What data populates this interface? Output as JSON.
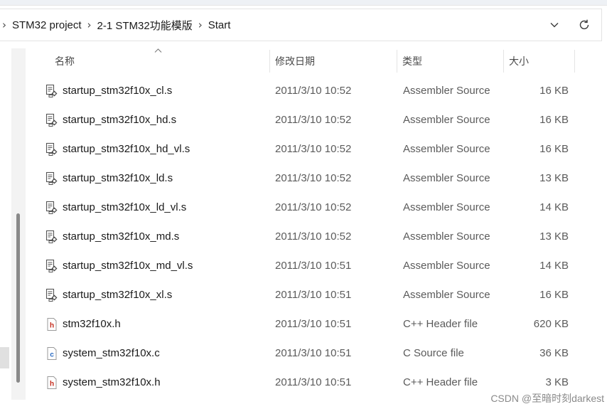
{
  "address": {
    "crumbs": [
      "STM32 project",
      "2-1 STM32功能模版",
      "Start"
    ],
    "separator": "›"
  },
  "columns": {
    "name": "名称",
    "date": "修改日期",
    "type": "类型",
    "size": "大小"
  },
  "files": [
    {
      "name": "startup_stm32f10x_cl.s",
      "date": "2011/3/10 10:52",
      "type": "Assembler Source",
      "size": "16 KB",
      "icon": "assembler-file-icon"
    },
    {
      "name": "startup_stm32f10x_hd.s",
      "date": "2011/3/10 10:52",
      "type": "Assembler Source",
      "size": "16 KB",
      "icon": "assembler-file-icon"
    },
    {
      "name": "startup_stm32f10x_hd_vl.s",
      "date": "2011/3/10 10:52",
      "type": "Assembler Source",
      "size": "16 KB",
      "icon": "assembler-file-icon"
    },
    {
      "name": "startup_stm32f10x_ld.s",
      "date": "2011/3/10 10:52",
      "type": "Assembler Source",
      "size": "13 KB",
      "icon": "assembler-file-icon"
    },
    {
      "name": "startup_stm32f10x_ld_vl.s",
      "date": "2011/3/10 10:52",
      "type": "Assembler Source",
      "size": "14 KB",
      "icon": "assembler-file-icon"
    },
    {
      "name": "startup_stm32f10x_md.s",
      "date": "2011/3/10 10:52",
      "type": "Assembler Source",
      "size": "13 KB",
      "icon": "assembler-file-icon"
    },
    {
      "name": "startup_stm32f10x_md_vl.s",
      "date": "2011/3/10 10:51",
      "type": "Assembler Source",
      "size": "14 KB",
      "icon": "assembler-file-icon"
    },
    {
      "name": "startup_stm32f10x_xl.s",
      "date": "2011/3/10 10:51",
      "type": "Assembler Source",
      "size": "16 KB",
      "icon": "assembler-file-icon"
    },
    {
      "name": "stm32f10x.h",
      "date": "2011/3/10 10:51",
      "type": "C++ Header file",
      "size": "620 KB",
      "icon": "header-file-icon"
    },
    {
      "name": "system_stm32f10x.c",
      "date": "2011/3/10 10:51",
      "type": "C Source file",
      "size": "36 KB",
      "icon": "c-source-file-icon"
    },
    {
      "name": "system_stm32f10x.h",
      "date": "2011/3/10 10:51",
      "type": "C++ Header file",
      "size": "3 KB",
      "icon": "header-file-icon"
    }
  ],
  "colors": {
    "header_file_accent": "#c42b1c",
    "c_source_accent": "#2b6cc4",
    "text_secondary": "#5b5b5b"
  },
  "watermark": "CSDN @至暗时刻darkest"
}
